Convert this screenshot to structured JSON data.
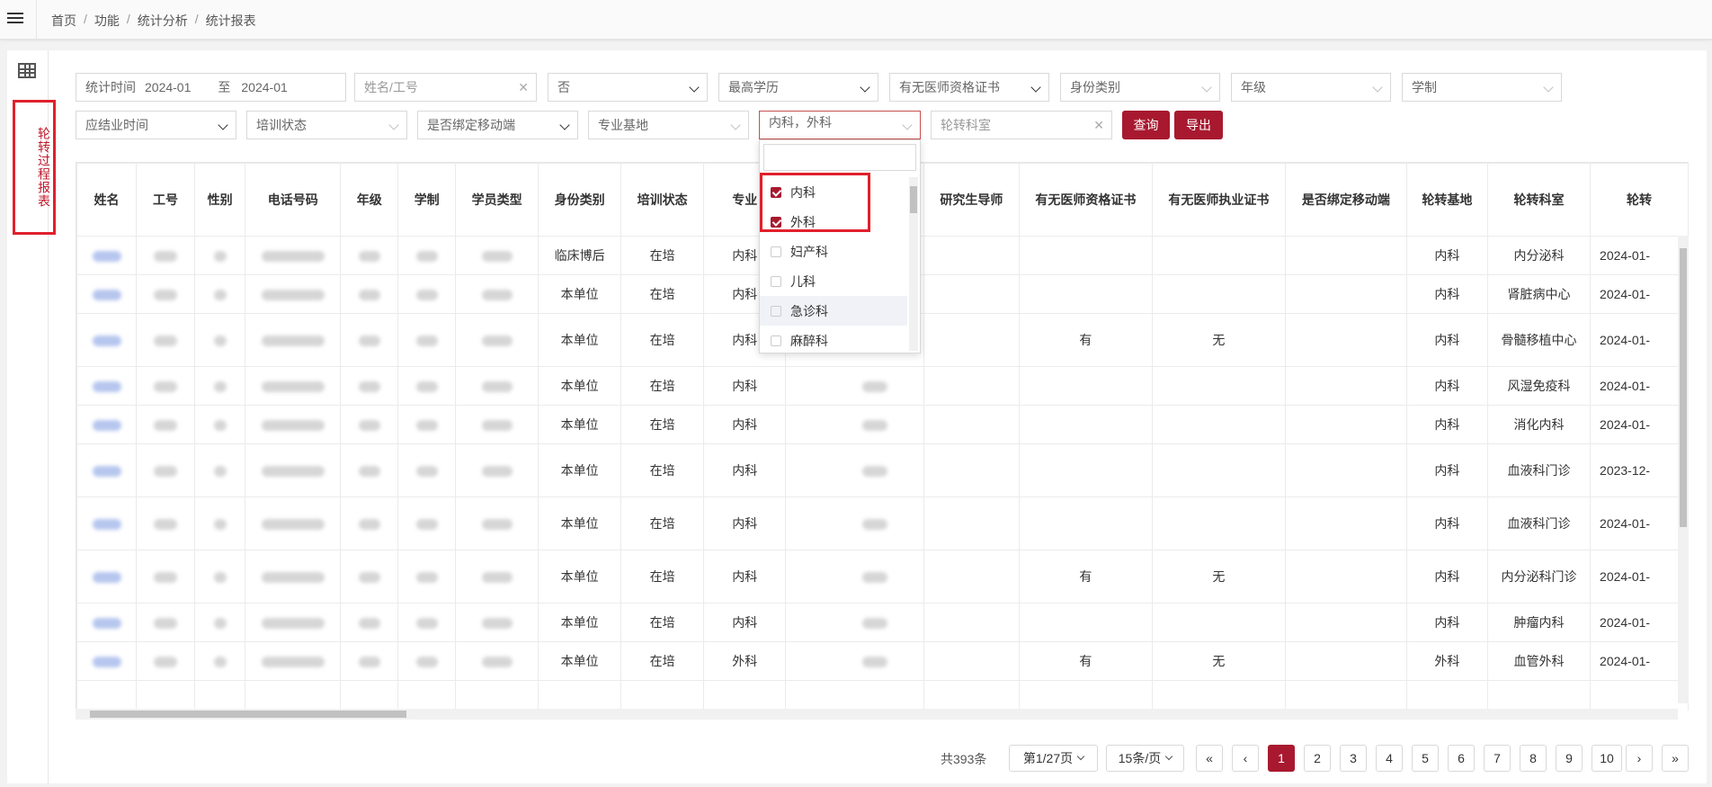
{
  "breadcrumb": [
    "首页",
    "功能",
    "统计分析",
    "统计报表"
  ],
  "left_rail": {
    "label": "轮转过程报表"
  },
  "filters": {
    "stat_time_label": "统计时间",
    "stat_start": "2024-01",
    "stat_to": "至",
    "stat_end": "2024-01",
    "name_placeholder": "姓名/工号",
    "select_no": "否",
    "education": "最高学历",
    "has_cert": "有无医师资格证书",
    "identity": "身份类别",
    "grade": "年级",
    "schooling": "学制",
    "grad_time": "应结业时间",
    "training_status": "培训状态",
    "bind_mobile": "是否绑定移动端",
    "major_base": "专业基地",
    "specialty_selected": "内科，外科",
    "rotation_dept_placeholder": "轮转科室",
    "query_button": "查询",
    "export_button": "导出"
  },
  "dropdown": {
    "items": [
      {
        "label": "内科",
        "checked": true
      },
      {
        "label": "外科",
        "checked": true
      },
      {
        "label": "妇产科",
        "checked": false
      },
      {
        "label": "儿科",
        "checked": false
      },
      {
        "label": "急诊科",
        "checked": false
      },
      {
        "label": "麻醉科",
        "checked": false
      }
    ]
  },
  "table": {
    "headers": [
      "姓名",
      "工号",
      "性别",
      "电话号码",
      "年级",
      "学制",
      "学员类型",
      "身份类别",
      "培训状态",
      "专业",
      "",
      "研究生导师",
      "有无医师资格证书",
      "有无医师执业证书",
      "是否绑定移动端",
      "轮转基地",
      "轮转科室",
      "轮转"
    ],
    "rows": [
      {
        "identity": "临床博后",
        "status": "在培",
        "major": "内科",
        "cert": "",
        "license": "",
        "base": "内科",
        "dept": "内分泌科",
        "date": "2024-01-"
      },
      {
        "identity": "本单位",
        "status": "在培",
        "major": "内科",
        "cert": "",
        "license": "",
        "base": "内科",
        "dept": "肾脏病中心",
        "date": "2024-01-"
      },
      {
        "identity": "本单位",
        "status": "在培",
        "major": "内科",
        "cert": "有",
        "license": "无",
        "base": "内科",
        "dept": "骨髓移植中心",
        "date": "2024-01-"
      },
      {
        "identity": "本单位",
        "status": "在培",
        "major": "内科",
        "cert": "",
        "license": "",
        "base": "内科",
        "dept": "风湿免疫科",
        "date": "2024-01-"
      },
      {
        "identity": "本单位",
        "status": "在培",
        "major": "内科",
        "cert": "",
        "license": "",
        "base": "内科",
        "dept": "消化内科",
        "date": "2024-01-"
      },
      {
        "identity": "本单位",
        "status": "在培",
        "major": "内科",
        "cert": "",
        "license": "",
        "base": "内科",
        "dept": "血液科门诊",
        "date": "2023-12-"
      },
      {
        "identity": "本单位",
        "status": "在培",
        "major": "内科",
        "cert": "",
        "license": "",
        "base": "内科",
        "dept": "血液科门诊",
        "date": "2024-01-"
      },
      {
        "identity": "本单位",
        "status": "在培",
        "major": "内科",
        "cert": "有",
        "license": "无",
        "base": "内科",
        "dept": "内分泌科门诊",
        "date": "2024-01-"
      },
      {
        "identity": "本单位",
        "status": "在培",
        "major": "内科",
        "cert": "",
        "license": "",
        "base": "内科",
        "dept": "肿瘤内科",
        "date": "2024-01-"
      },
      {
        "identity": "本单位",
        "status": "在培",
        "major": "外科",
        "cert": "有",
        "license": "无",
        "base": "外科",
        "dept": "血管外科",
        "date": "2024-01-"
      }
    ]
  },
  "pagination": {
    "total": "共393条",
    "page_select": "第1/27页",
    "page_size": "15条/页",
    "first": "«",
    "prev": "‹",
    "pages": [
      "1",
      "2",
      "3",
      "4",
      "5",
      "6",
      "7",
      "8",
      "9",
      "10"
    ],
    "current": "1",
    "next": "›",
    "last": "»"
  },
  "colors": {
    "accent": "#a8192f",
    "highlight": "#e0202c"
  }
}
